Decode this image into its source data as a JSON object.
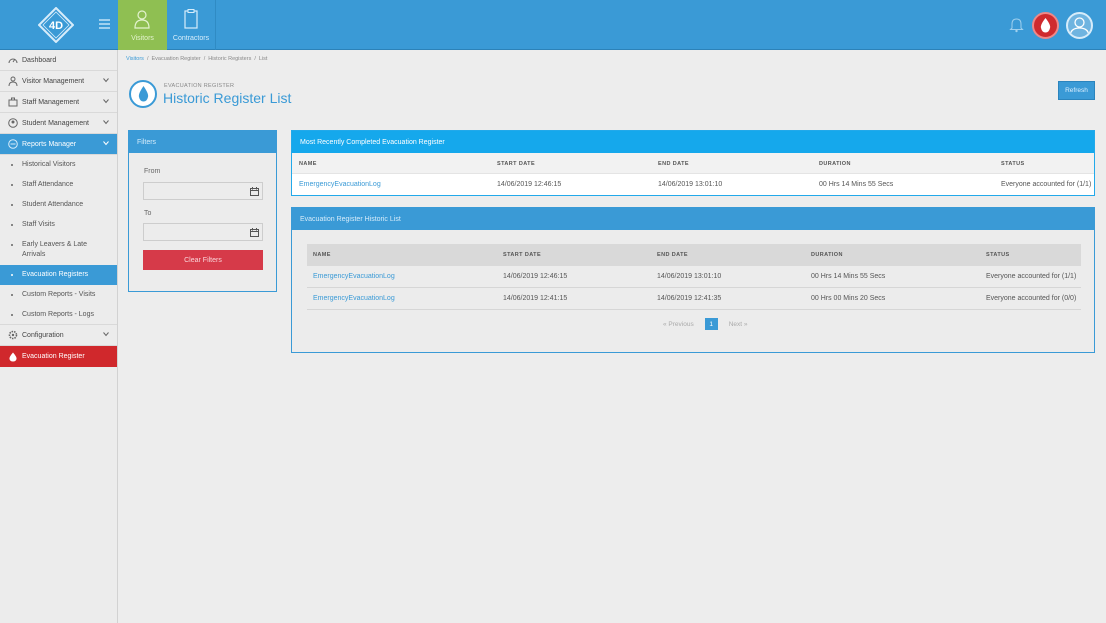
{
  "topbar": {
    "tabs": [
      {
        "label": "Visitors",
        "icon": "visitor-icon"
      },
      {
        "label": "Contractors",
        "icon": "clipboard-icon"
      }
    ],
    "accent": "#3a9ad6",
    "visitors_tab_color": "#8fbf52"
  },
  "sidebar": {
    "items": [
      {
        "label": "Dashboard",
        "icon": "dashboard-icon"
      },
      {
        "label": "Visitor Management",
        "icon": "visitor-icon"
      },
      {
        "label": "Staff Management",
        "icon": "staff-icon"
      },
      {
        "label": "Student Management",
        "icon": "student-icon"
      },
      {
        "label": "Reports Manager",
        "icon": "reports-icon"
      }
    ],
    "reports_sub": [
      {
        "label": "Historical Visitors"
      },
      {
        "label": "Staff Attendance"
      },
      {
        "label": "Student Attendance"
      },
      {
        "label": "Staff Visits"
      },
      {
        "label": "Early Leavers & Late Arrivals"
      },
      {
        "label": "Evacuation Registers"
      },
      {
        "label": "Custom Reports - Visits"
      },
      {
        "label": "Custom Reports - Logs"
      }
    ],
    "configuration": "Configuration",
    "evacuation": "Evacuation Register"
  },
  "breadcrumb": [
    "Visitors",
    "Evacuation Register",
    "Historic Registers",
    "List"
  ],
  "page": {
    "subtitle": "EVACUATION REGISTER",
    "title": "Historic Register List",
    "refresh": "Refresh"
  },
  "filters": {
    "title": "Filters",
    "from_label": "From",
    "to_label": "To",
    "from_value": "",
    "to_value": "",
    "clear": "Clear Filters"
  },
  "recent": {
    "title": "Most Recently Completed Evacuation Register",
    "headers": [
      "NAME",
      "START DATE",
      "END DATE",
      "DURATION",
      "STATUS"
    ],
    "row": [
      "EmergencyEvacuationLog",
      "14/06/2019 12:46:15",
      "14/06/2019 13:01:10",
      "00 Hrs 14 Mins 55 Secs",
      "Everyone accounted for (1/1)"
    ]
  },
  "historic": {
    "title": "Evacuation Register Historic List",
    "headers": [
      "NAME",
      "START DATE",
      "END DATE",
      "DURATION",
      "STATUS"
    ],
    "rows": [
      [
        "EmergencyEvacuationLog",
        "14/06/2019 12:46:15",
        "14/06/2019 13:01:10",
        "00 Hrs 14 Mins 55 Secs",
        "Everyone accounted for (1/1)"
      ],
      [
        "EmergencyEvacuationLog",
        "14/06/2019 12:41:15",
        "14/06/2019 12:41:35",
        "00 Hrs 00 Mins 20 Secs",
        "Everyone accounted for (0/0)"
      ]
    ],
    "pager": {
      "prev": "« Previous",
      "current": "1",
      "next": "Next »"
    }
  }
}
